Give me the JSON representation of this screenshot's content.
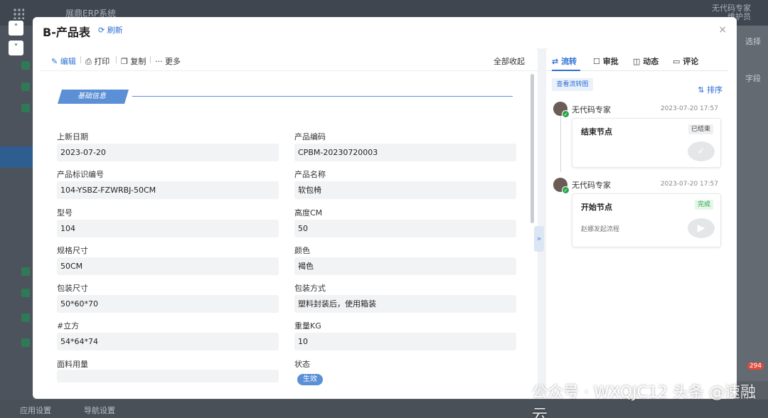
{
  "app": {
    "title": "展鼎ERP系统",
    "user_name": "无代码专家",
    "user_sub": "维护员",
    "bottom_left": "应用设置",
    "bottom_mid": "导航设置",
    "right_text": "字段",
    "right_text2": "选择"
  },
  "modal": {
    "title": "B-产品表",
    "refresh_label": "刷新",
    "close_label": "×"
  },
  "toolbar": {
    "edit": "编辑",
    "print": "打印",
    "copy": "复制",
    "more": "更多",
    "collapse_all": "全部收起"
  },
  "section": {
    "title": "基础信息"
  },
  "fields": [
    {
      "label": "上新日期",
      "value": "2023-07-20"
    },
    {
      "label": "产品编码",
      "value": "CPBM-20230720003"
    },
    {
      "label": "产品标识编号",
      "value": "104-YSBZ-FZWRBJ-50CM"
    },
    {
      "label": "产品名称",
      "value": "软包椅"
    },
    {
      "label": "型号",
      "value": "104"
    },
    {
      "label": "高度CM",
      "value": "50"
    },
    {
      "label": "规格尺寸",
      "value": "50CM"
    },
    {
      "label": "颜色",
      "value": "褐色"
    },
    {
      "label": "包装尺寸",
      "value": "50*60*70"
    },
    {
      "label": "包装方式",
      "value": "塑料封装后，使用箱装"
    },
    {
      "label": "#立方",
      "value": "54*64*74"
    },
    {
      "label": "重量KG",
      "value": "10"
    },
    {
      "label": "面料用量",
      "value": ""
    },
    {
      "label": "状态",
      "value": "生效"
    }
  ],
  "right_tabs": {
    "flow": "流转",
    "approve": "审批",
    "activity": "动态",
    "comment": "评论"
  },
  "flow": {
    "view_chart": "查看流转图",
    "sort": "排序",
    "events": [
      {
        "user": "无代码专家",
        "time": "2023-07-20 17:57",
        "node": "结束节点",
        "status": "已结束",
        "note": ""
      },
      {
        "user": "无代码专家",
        "time": "2023-07-20 17:57",
        "node": "开始节点",
        "status": "完成",
        "note": "赵娜发起流程"
      }
    ]
  },
  "watermark": "公众号 · WXQJC12   头条 @速融云",
  "badge_count": "294"
}
